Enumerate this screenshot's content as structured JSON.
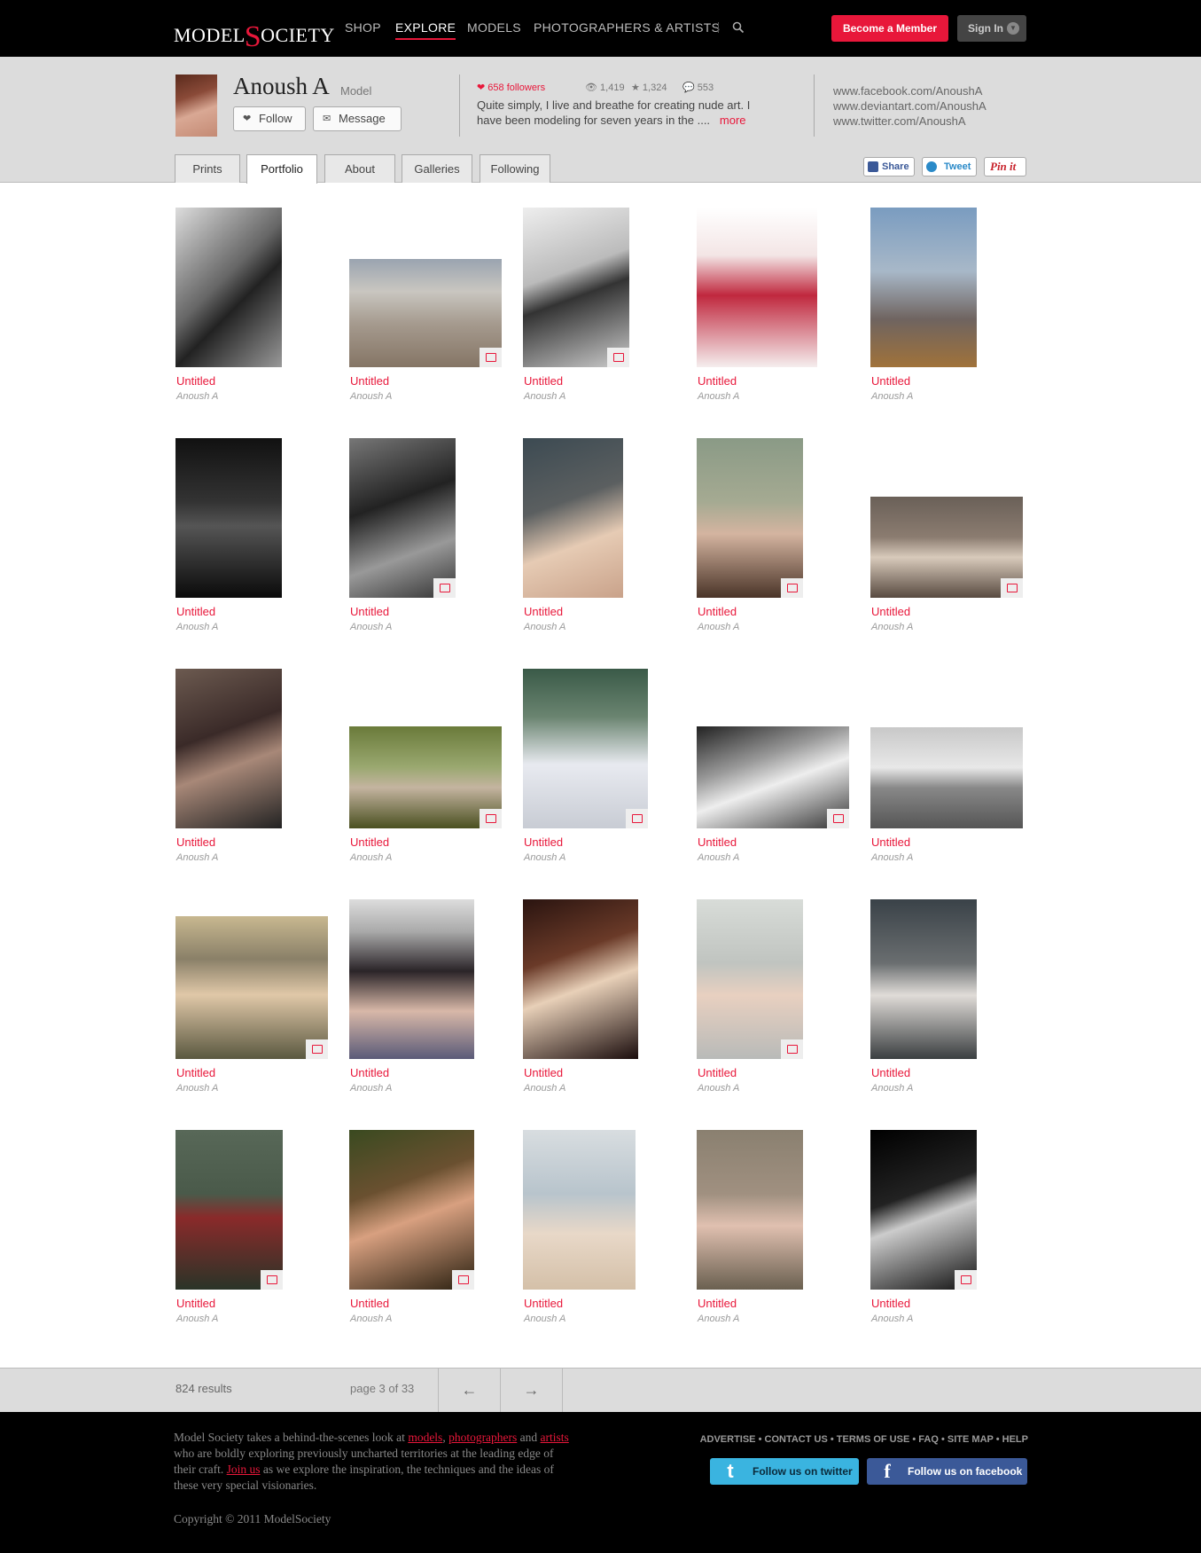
{
  "header": {
    "logo_left": "MODEL",
    "logo_s": "S",
    "logo_right": "OCIETY",
    "nav": [
      "SHOP",
      "EXPLORE",
      "MODELS",
      "PHOTOGRAPHERS & ARTISTS"
    ],
    "active_nav": "EXPLORE",
    "member_label": "Become a Member",
    "signin_label": "Sign In"
  },
  "profile": {
    "name": "Anoush A",
    "role": "Model",
    "follow_label": "Follow",
    "message_label": "Message",
    "followers": "658 followers",
    "views": "1,419",
    "favorites": "1,324",
    "comments": "553",
    "bio": "Quite simply, I live and breathe for creating nude art. I have been modeling for seven years in the ....",
    "more_label": "more",
    "links": [
      "www.facebook.com/AnoushA",
      "www.deviantart.com/AnoushA",
      "www.twitter.com/AnoushA"
    ]
  },
  "tabs": [
    "Prints",
    "Portfolio",
    "About",
    "Galleries",
    "Following"
  ],
  "active_tab": "Portfolio",
  "share": {
    "facebook": "Share",
    "twitter": "Tweet",
    "pinterest": "Pin it"
  },
  "portfolio": {
    "items": [
      {
        "title": "Untitled",
        "author": "Anoush A",
        "print": false
      },
      {
        "title": "Untitled",
        "author": "Anoush A",
        "print": true
      },
      {
        "title": "Untitled",
        "author": "Anoush A",
        "print": true
      },
      {
        "title": "Untitled",
        "author": "Anoush A",
        "print": false
      },
      {
        "title": "Untitled",
        "author": "Anoush A",
        "print": false
      },
      {
        "title": "Untitled",
        "author": "Anoush A",
        "print": false
      },
      {
        "title": "Untitled",
        "author": "Anoush A",
        "print": true
      },
      {
        "title": "Untitled",
        "author": "Anoush A",
        "print": false
      },
      {
        "title": "Untitled",
        "author": "Anoush A",
        "print": true
      },
      {
        "title": "Untitled",
        "author": "Anoush A",
        "print": true
      },
      {
        "title": "Untitled",
        "author": "Anoush A",
        "print": false
      },
      {
        "title": "Untitled",
        "author": "Anoush A",
        "print": true
      },
      {
        "title": "Untitled",
        "author": "Anoush A",
        "print": true
      },
      {
        "title": "Untitled",
        "author": "Anoush A",
        "print": true
      },
      {
        "title": "Untitled",
        "author": "Anoush A",
        "print": false
      },
      {
        "title": "Untitled",
        "author": "Anoush A",
        "print": true
      },
      {
        "title": "Untitled",
        "author": "Anoush A",
        "print": false
      },
      {
        "title": "Untitled",
        "author": "Anoush A",
        "print": false
      },
      {
        "title": "Untitled",
        "author": "Anoush A",
        "print": true
      },
      {
        "title": "Untitled",
        "author": "Anoush A",
        "print": false
      },
      {
        "title": "Untitled",
        "author": "Anoush A",
        "print": true
      },
      {
        "title": "Untitled",
        "author": "Anoush A",
        "print": true
      },
      {
        "title": "Untitled",
        "author": "Anoush A",
        "print": false
      },
      {
        "title": "Untitled",
        "author": "Anoush A",
        "print": false
      },
      {
        "title": "Untitled",
        "author": "Anoush A",
        "print": true
      }
    ]
  },
  "pagination": {
    "results": "824 results",
    "page": "page 3 of 33",
    "prev": "←",
    "next": "→"
  },
  "footer": {
    "desc_1": "Model Society takes a behind-the-scenes look at ",
    "link_models": "models",
    "sep_comma": ", ",
    "link_photographers": "photographers",
    "desc_2": " and ",
    "link_artists": "artists",
    "desc_3": " who are boldly exploring previously uncharted territories at the leading edge of their craft. ",
    "link_join": "Join us",
    "desc_4": " as we explore the inspiration, the techniques and the ideas of these very special visionaries.",
    "copyright": "Copyright © 2011 ModelSociety",
    "links": [
      "ADVERTISE",
      "CONTACT US",
      "TERMS OF USE",
      "FAQ",
      "SITE MAP",
      "HELP"
    ],
    "twitter_label": "Follow us on twitter",
    "facebook_label": "Follow us on facebook"
  },
  "colors": {
    "accent": "#e8173a",
    "header_bg": "#000000",
    "profile_bg": "#dcdcdc",
    "twitter": "#3ab4e0",
    "facebook": "#3b5998"
  }
}
